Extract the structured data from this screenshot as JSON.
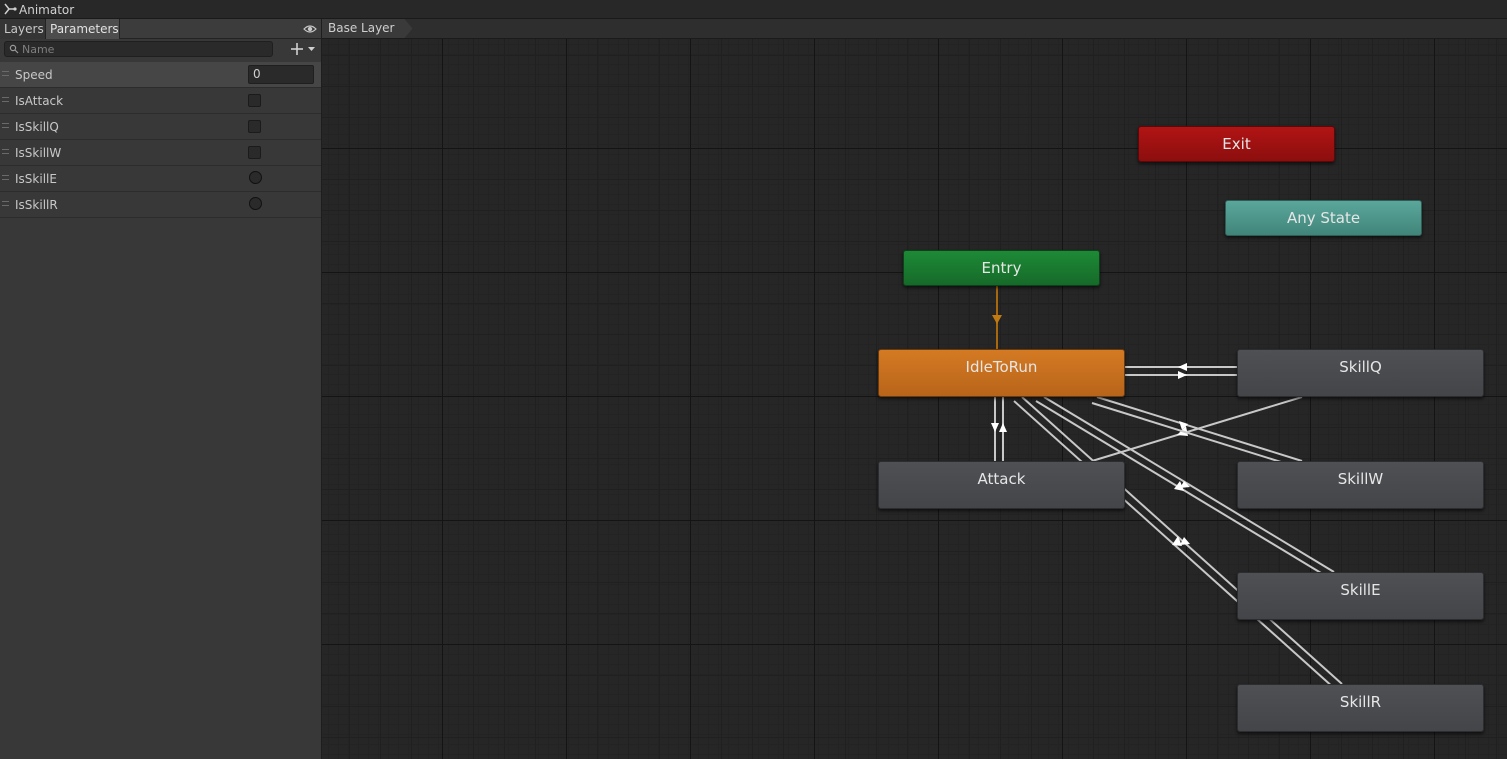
{
  "window": {
    "title": "Animator"
  },
  "tabs": {
    "layers": "Layers",
    "parameters": "Parameters"
  },
  "search": {
    "placeholder": "Name",
    "value": ""
  },
  "parameters": [
    {
      "name": "Speed",
      "type": "float",
      "value": "0"
    },
    {
      "name": "IsAttack",
      "type": "bool",
      "checked": false
    },
    {
      "name": "IsSkillQ",
      "type": "bool",
      "checked": false
    },
    {
      "name": "IsSkillW",
      "type": "bool",
      "checked": false
    },
    {
      "name": "IsSkillE",
      "type": "trigger"
    },
    {
      "name": "IsSkillR",
      "type": "trigger"
    }
  ],
  "breadcrumb": {
    "layer": "Base Layer"
  },
  "states": {
    "exit": "Exit",
    "any_state": "Any State",
    "entry": "Entry",
    "idle_to_run": "IdleToRun",
    "attack": "Attack",
    "skill_q": "SkillQ",
    "skill_w": "SkillW",
    "skill_e": "SkillE",
    "skill_r": "SkillR"
  },
  "colors": {
    "exit": "#a11212",
    "any_state": "#4c978b",
    "entry": "#1a7b31",
    "default_state": "#c86f1f",
    "state": "#48494d",
    "default_transition": "#b5710e",
    "transition": "#c8c8c8"
  }
}
